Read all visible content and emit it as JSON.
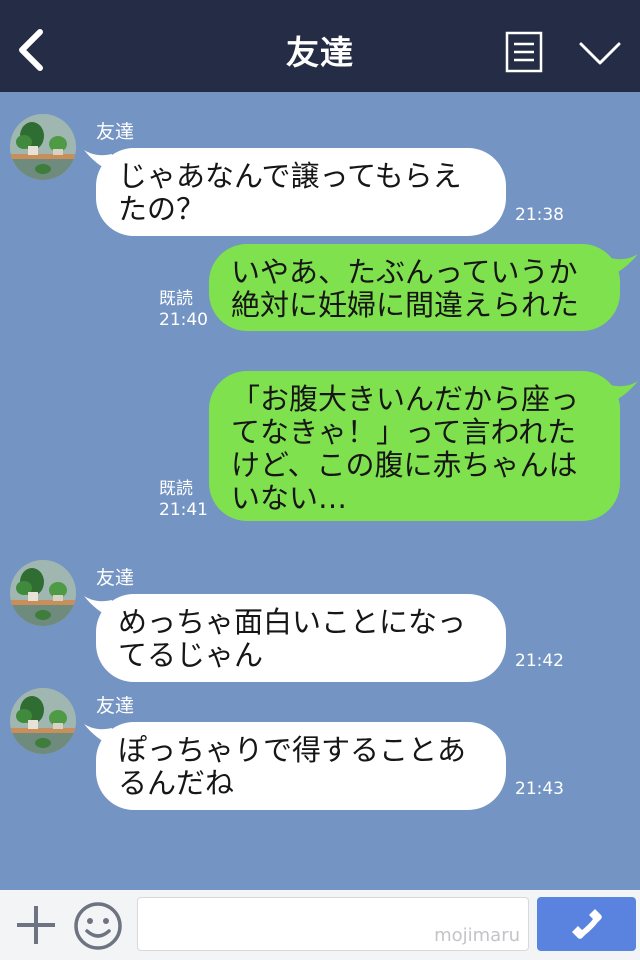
{
  "header": {
    "title": "友達",
    "back_icon": "chevron-left-icon",
    "note_icon": "notes-icon",
    "menu_icon": "chevron-down-icon",
    "background": "#242d45"
  },
  "chat": {
    "background": "#7494c3",
    "messages": [
      {
        "side": "left",
        "sender": "友達",
        "text": "じゃあなんで譲ってもらえ\nたの？",
        "time": "21:38"
      },
      {
        "side": "right",
        "read": "既読",
        "time": "21:40",
        "text": "いやあ、たぶんっていうか\n絶対に妊婦に間違えられた"
      },
      {
        "side": "right",
        "read": "既読",
        "time": "21:41",
        "text": "「お腹大きいんだから座っ\nてなきゃ！」って言われた\nけど、この腹に赤ちゃんは\nいない…"
      },
      {
        "side": "left",
        "sender": "友達",
        "text": "めっちゃ面白いことになっ\nてるじゃん",
        "time": "21:42"
      },
      {
        "side": "left",
        "sender": "友達",
        "text": "ぽっちゃりで得することあ\nるんだね",
        "time": "21:43"
      }
    ]
  },
  "footer": {
    "plus_icon": "plus-icon",
    "emoji_icon": "smiley-icon",
    "watermark": "mojimaru",
    "call_icon": "phone-icon",
    "call_color": "#5a82df"
  },
  "colors": {
    "sent_bubble": "#7fe14e",
    "received_bubble": "#ffffff"
  }
}
